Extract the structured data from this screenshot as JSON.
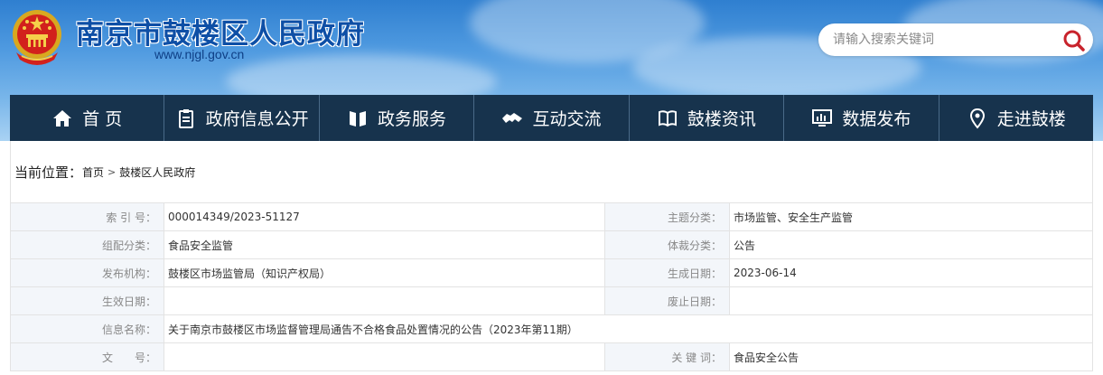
{
  "header": {
    "site_title": "南京市鼓楼区人民政府",
    "site_url": "www.njgl.gov.cn",
    "search": {
      "placeholder": "请输入搜索关键词"
    }
  },
  "nav": {
    "items": [
      {
        "label": "首 页",
        "icon": "home-icon"
      },
      {
        "label": "政府信息公开",
        "icon": "document-icon"
      },
      {
        "label": "政务服务",
        "icon": "book-icon"
      },
      {
        "label": "互动交流",
        "icon": "handshake-icon"
      },
      {
        "label": "鼓楼资讯",
        "icon": "news-icon"
      },
      {
        "label": "数据发布",
        "icon": "monitor-chart-icon"
      },
      {
        "label": "走进鼓楼",
        "icon": "location-pin-icon"
      }
    ]
  },
  "breadcrumb": {
    "label": "当前位置：",
    "items": [
      "首页",
      "鼓楼区人民政府"
    ],
    "separator": ">"
  },
  "meta": {
    "index_label": "索 引 号：",
    "index_value": "000014349/2023-51127",
    "topic_label": "主题分类：",
    "topic_value": "市场监管、安全生产监管",
    "org_cat_label": "组配分类：",
    "org_cat_value": "食品安全监管",
    "genre_label": "体裁分类：",
    "genre_value": "公告",
    "publisher_label": "发布机构：",
    "publisher_value": "鼓楼区市场监管局（知识产权局）",
    "created_label": "生成日期：",
    "created_value": "2023-06-14",
    "effective_label": "生效日期：",
    "effective_value": "",
    "abolish_label": "废止日期：",
    "abolish_value": "",
    "name_label": "信息名称：",
    "name_value": "关于南京市鼓楼区市场监督管理局通告不合格食品处置情况的公告（2023年第11期）",
    "docno_label": "文　　号：",
    "docno_value": "",
    "keyword_label": "关 键 词：",
    "keyword_value": "食品安全公告"
  }
}
